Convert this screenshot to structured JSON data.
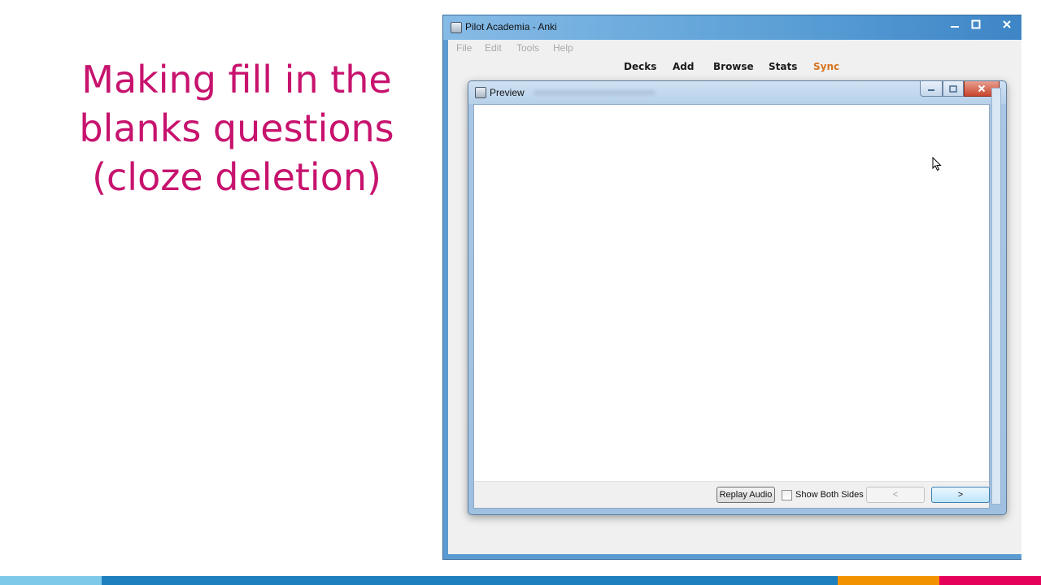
{
  "slide": {
    "title_lines": [
      "Making fill in the",
      "blanks questions",
      "(cloze deletion)"
    ],
    "title_color": "#c8136e"
  },
  "main_window": {
    "title": "Pilot Academia - Anki",
    "menu": [
      "File",
      "Edit",
      "Tools",
      "Help"
    ],
    "toolbar": {
      "decks": "Decks",
      "add": "Add",
      "browse": "Browse",
      "stats": "Stats",
      "sync": "Sync",
      "sync_color": "#d7731d"
    }
  },
  "preview": {
    "title": "Preview",
    "replay_audio": "Replay Audio",
    "show_both_sides": "Show Both Sides",
    "show_both_sides_checked": false,
    "prev": "<",
    "next": ">"
  },
  "bottom_bar_colors": [
    "#7ec8ea",
    "#1d7fbd",
    "#f39200",
    "#e5005a"
  ]
}
